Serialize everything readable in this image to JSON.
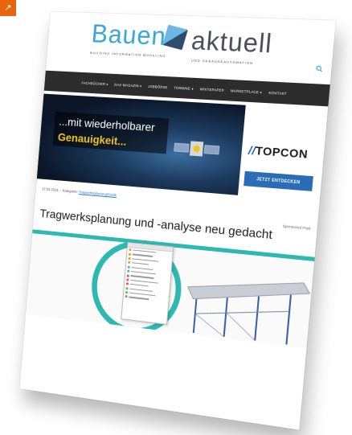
{
  "corner_badge": {
    "icon": "arrow-icon",
    "glyph": "↗",
    "color": "#e8650f"
  },
  "logo": {
    "word_1": "Bauen",
    "word_2": "aktuell",
    "tagline_1": "BUILDING INFORMATION MODELING",
    "tagline_2": "UND GEBÄUDEAUTOMATION",
    "brand_color": "#3aa6d6"
  },
  "nav": {
    "items": [
      {
        "label": "FACHBÜCHER ▾"
      },
      {
        "label": "DAS MAGAZIN ▾"
      },
      {
        "label": "JOBBÖRSE"
      },
      {
        "label": "TERMINE ▾"
      },
      {
        "label": "WHITEPAPER"
      },
      {
        "label": "MARKETPLACE ▾"
      },
      {
        "label": "KONTAKT"
      }
    ]
  },
  "banner": {
    "line_1": "...mit wiederholbarer",
    "line_2": "Genauigkeit...",
    "brand": "TOPCON",
    "cta": "JETZT ENTDECKEN"
  },
  "article": {
    "date_category": "17.03.2021 – Kategorie:",
    "category": "Tragwerksplanung/Statik",
    "sponsored": "Sponsored Post",
    "title": "Tragwerksplanung und -analyse neu gedacht"
  },
  "image": {
    "accent": "#2eb8b2"
  }
}
